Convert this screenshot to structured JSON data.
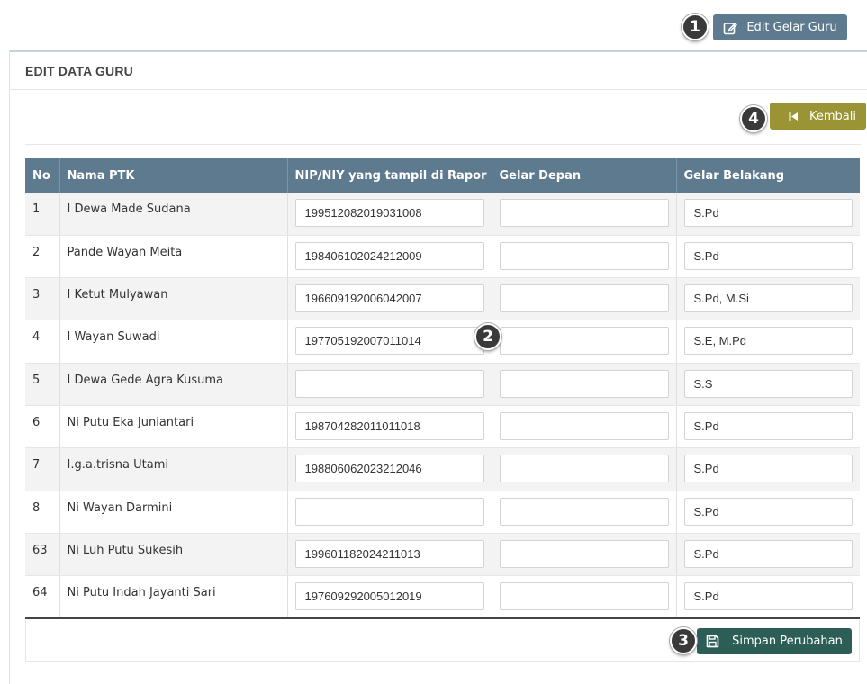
{
  "header": {
    "edit_gelar_label": "Edit Gelar Guru"
  },
  "panel": {
    "title": "EDIT DATA GURU",
    "back_label": "Kembali",
    "save_label": "Simpan Perubahan"
  },
  "markers": [
    "1",
    "2",
    "3",
    "4"
  ],
  "table": {
    "headers": [
      "No",
      "Nama PTK",
      "NIP/NIY yang tampil di Rapor",
      "Gelar Depan",
      "Gelar Belakang"
    ],
    "rows": [
      {
        "no": "1",
        "nama": "I Dewa Made Sudana",
        "nip": "199512082019031008",
        "gelar_depan": "",
        "gelar_belakang": "S.Pd"
      },
      {
        "no": "2",
        "nama": "Pande Wayan Meita",
        "nip": "198406102024212009",
        "gelar_depan": "",
        "gelar_belakang": "S.Pd"
      },
      {
        "no": "3",
        "nama": "I Ketut Mulyawan",
        "nip": "196609192006042007",
        "gelar_depan": "",
        "gelar_belakang": "S.Pd, M.Si"
      },
      {
        "no": "4",
        "nama": "I Wayan Suwadi",
        "nip": "197705192007011014",
        "gelar_depan": "",
        "gelar_belakang": "S.E, M.Pd"
      },
      {
        "no": "5",
        "nama": "I Dewa Gede Agra Kusuma",
        "nip": "",
        "gelar_depan": "",
        "gelar_belakang": "S.S"
      },
      {
        "no": "6",
        "nama": "Ni Putu Eka Juniantari",
        "nip": "198704282011011018",
        "gelar_depan": "",
        "gelar_belakang": "S.Pd"
      },
      {
        "no": "7",
        "nama": "I.g.a.trisna Utami",
        "nip": "198806062023212046",
        "gelar_depan": "",
        "gelar_belakang": "S.Pd"
      },
      {
        "no": "8",
        "nama": "Ni Wayan Darmini",
        "nip": "",
        "gelar_depan": "",
        "gelar_belakang": "S.Pd"
      },
      {
        "no": "63",
        "nama": "Ni Luh Putu Sukesih",
        "nip": "199601182024211013",
        "gelar_depan": "",
        "gelar_belakang": "S.Pd"
      },
      {
        "no": "64",
        "nama": "Ni Putu Indah Jayanti Sari",
        "nip": "197609292005012019",
        "gelar_depan": "",
        "gelar_belakang": "S.Pd"
      }
    ]
  },
  "colors": {
    "header_bg": "#5d7a8f",
    "back_button": "#9b9435",
    "save_button": "#2d5e56"
  }
}
